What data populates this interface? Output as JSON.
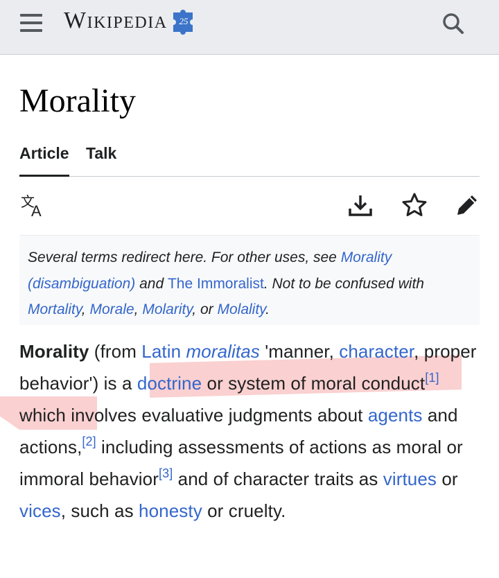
{
  "header": {
    "menu_icon": "hamburger-menu-icon",
    "logo_text": "Wikipedia",
    "logo_badge": "25",
    "search_icon": "search-icon"
  },
  "page": {
    "title": "Morality"
  },
  "tabs": [
    {
      "label": "Article",
      "active": true
    },
    {
      "label": "Talk",
      "active": false
    }
  ],
  "toolbar": {
    "language_icon": "language-icon",
    "download_icon": "download-icon",
    "watch_icon": "star-icon",
    "edit_icon": "pencil-icon"
  },
  "hatnote": {
    "part1": "Several terms redirect here. For other uses, see ",
    "link1": "Morality (disambiguation)",
    "part2": " and ",
    "link2": "The Immoralist",
    "part3": ". Not to be confused with ",
    "link3": "Mortality",
    "sep1": ", ",
    "link4": "Morale",
    "sep2": ", ",
    "link5": "Molarity",
    "sep3": ", or ",
    "link6": "Molality",
    "end": "."
  },
  "paragraph": {
    "t1": "Morality",
    "t2": " (from ",
    "l1": "Latin",
    "t3": " ",
    "t4": "moralitas",
    "t5": " 'manner, ",
    "l2": "character",
    "t6": ", proper behavior') is a ",
    "l3": "doctrine",
    "t7": " or system of moral conduct",
    "r1": "[1]",
    "t8": " which involves evaluative judgments about ",
    "l4": "agents",
    "t9": " and actions,",
    "r2": "[2]",
    "t10": " including assessments of actions as moral or immoral behavior",
    "r3": "[3]",
    "t11": " and of character traits as ",
    "l5": "virtues",
    "t12": " or ",
    "l6": "vices",
    "t13": ", such as ",
    "l7": "honesty",
    "t14": " or cruelty."
  },
  "colors": {
    "link": "#3366cc",
    "header_bg": "#eaecf0",
    "hatnote_bg": "#f8f9fa",
    "highlight": "#f07878"
  }
}
